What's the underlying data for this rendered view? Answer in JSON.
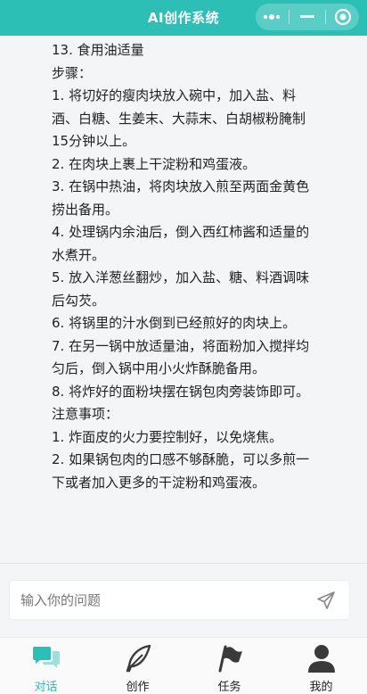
{
  "header": {
    "title": "AI创作系统",
    "menu_icon": "more-dots-icon",
    "minimize_icon": "minus-icon",
    "close_icon": "target-circle-icon"
  },
  "content": {
    "lines": [
      "13. 食用油适量",
      "步骤：",
      "1. 将切好的瘦肉块放入碗中，加入盐、料",
      "酒、白糖、生姜末、大蒜末、白胡椒粉腌制",
      "15分钟以上。",
      "2. 在肉块上裹上干淀粉和鸡蛋液。",
      "3. 在锅中热油，将肉块放入煎至两面金黄色",
      "捞出备用。",
      "4. 处理锅内余油后，倒入西红柿酱和适量的",
      "水煮开。",
      "5. 放入洋葱丝翻炒，加入盐、糖、料酒调味",
      "后勾芡。",
      "6. 将锅里的汁水倒到已经煎好的肉块上。",
      "7. 在另一锅中放适量油，将面粉加入搅拌均",
      "匀后，倒入锅中用小火炸酥脆备用。",
      "8. 将炸好的面粉块摆在锅包肉旁装饰即可。",
      "注意事项：",
      "1. 炸面皮的火力要控制好，以免烧焦。",
      "2. 如果锅包肉的口感不够酥脆，可以多煎一",
      "下或者加入更多的干淀粉和鸡蛋液。"
    ]
  },
  "input": {
    "value": "",
    "placeholder": "输入你的问题",
    "send_icon": "send-icon"
  },
  "tabs": [
    {
      "label": "对话",
      "icon": "chat-bubbles-icon",
      "active": true
    },
    {
      "label": "创作",
      "icon": "feather-icon",
      "active": false
    },
    {
      "label": "任务",
      "icon": "flag-icon",
      "active": false
    },
    {
      "label": "我的",
      "icon": "user-icon",
      "active": false
    }
  ],
  "colors": {
    "accent": "#2bbfb6",
    "background": "#f4f5f7",
    "tab_icon_inactive": "#3a3a3a"
  }
}
